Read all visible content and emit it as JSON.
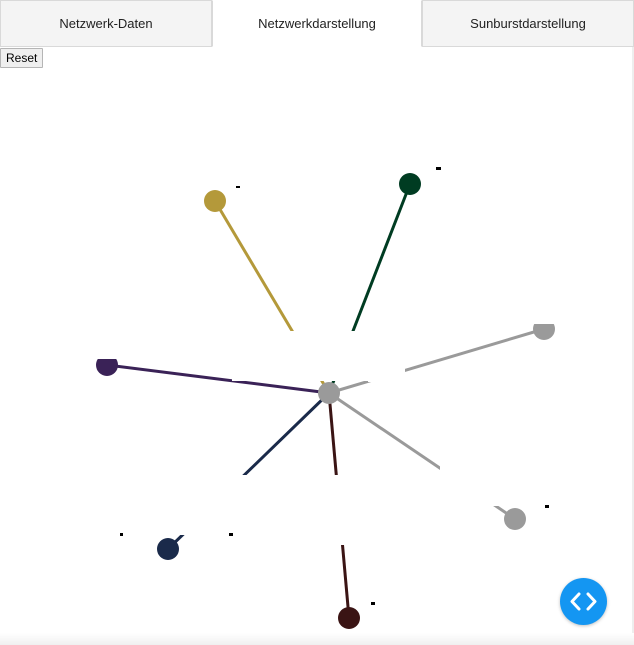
{
  "tabs": [
    {
      "label": "Netzwerk-Daten",
      "active": false
    },
    {
      "label": "Netzwerkdarstellung",
      "active": true
    },
    {
      "label": "Sunburstdarstellung",
      "active": false
    }
  ],
  "reset_label": "Reset",
  "graph": {
    "colors": {
      "center": "#9a9a9a",
      "olive": "#b4993a",
      "darkgreen": "#003c22",
      "purple": "#3a2257",
      "navy": "#1a2a4a",
      "maroon": "#3a1414",
      "gray": "#9a9a9a"
    }
  },
  "fab_icon": "code-icon"
}
